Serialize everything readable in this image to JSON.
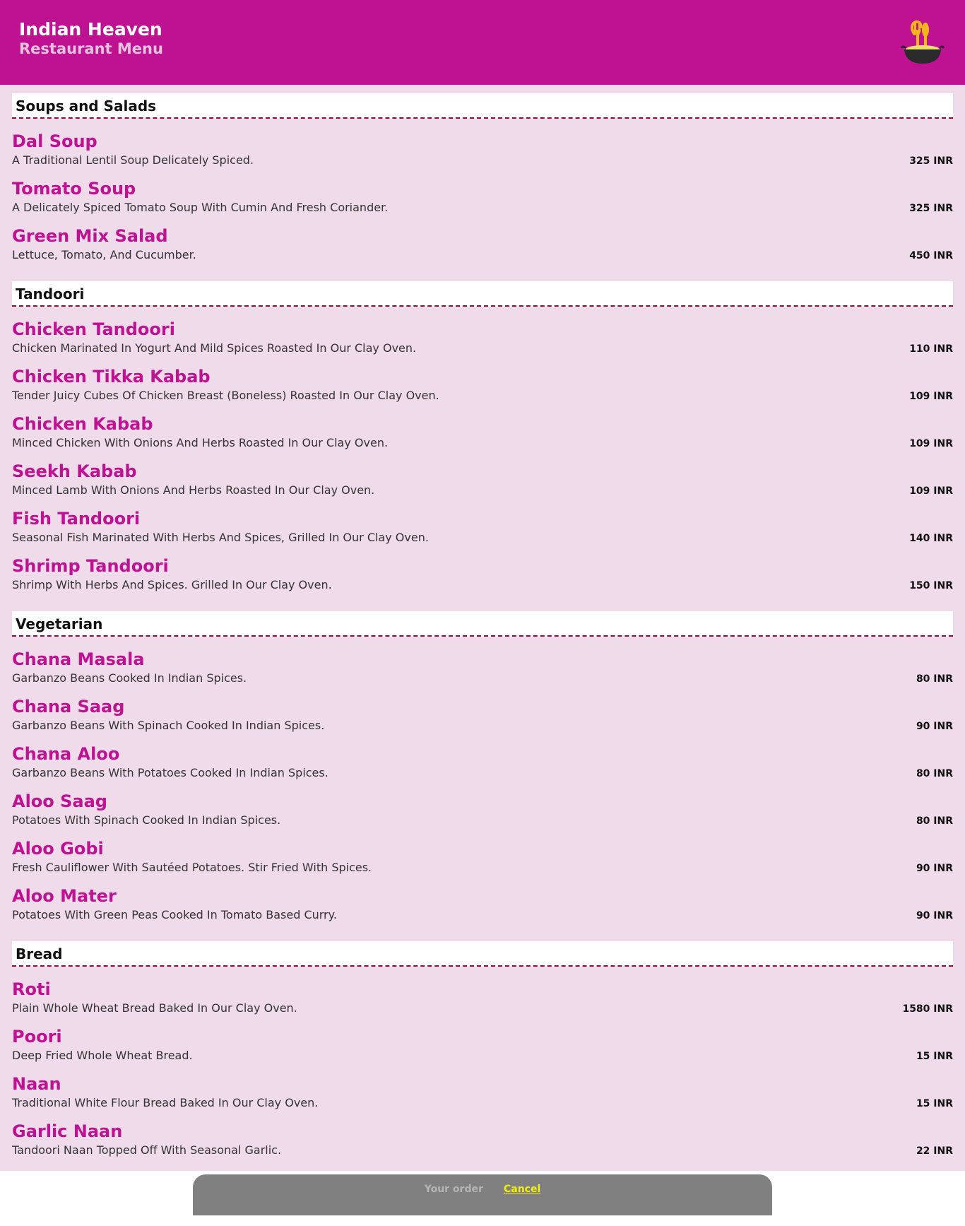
{
  "header": {
    "restaurant_name": "Indian Heaven",
    "subtitle": "Restaurant Menu",
    "logo_icon": "cooking-pot-icon"
  },
  "colors": {
    "brand": "#bf1293",
    "page_background": "#efdbea",
    "divider": "#8b0e3a",
    "order_bar": "#808080",
    "cancel_link": "#f4f200"
  },
  "sections": [
    {
      "title": "Soups and Salads",
      "items": [
        {
          "name": "Dal Soup",
          "description": "A Traditional Lentil Soup Delicately Spiced.",
          "price": "325 INR"
        },
        {
          "name": "Tomato Soup",
          "description": "A Delicately Spiced Tomato Soup With Cumin And Fresh Coriander.",
          "price": "325 INR"
        },
        {
          "name": "Green Mix Salad",
          "description": "Lettuce, Tomato, And Cucumber.",
          "price": "450 INR"
        }
      ]
    },
    {
      "title": "Tandoori",
      "items": [
        {
          "name": "Chicken Tandoori",
          "description": "Chicken Marinated In Yogurt And Mild Spices Roasted In Our Clay Oven.",
          "price": "110 INR"
        },
        {
          "name": "Chicken Tikka Kabab",
          "description": "Tender Juicy Cubes Of Chicken Breast (Boneless) Roasted In Our Clay Oven.",
          "price": "109 INR"
        },
        {
          "name": "Chicken Kabab",
          "description": "Minced Chicken With Onions And Herbs Roasted In Our Clay Oven.",
          "price": "109 INR"
        },
        {
          "name": "Seekh Kabab",
          "description": "Minced Lamb With Onions And Herbs Roasted In Our Clay Oven.",
          "price": "109 INR"
        },
        {
          "name": "Fish Tandoori",
          "description": "Seasonal Fish Marinated With Herbs And Spices, Grilled In Our Clay Oven.",
          "price": "140 INR"
        },
        {
          "name": "Shrimp Tandoori",
          "description": "Shrimp With Herbs And Spices. Grilled In Our Clay Oven.",
          "price": "150 INR"
        }
      ]
    },
    {
      "title": "Vegetarian",
      "items": [
        {
          "name": "Chana Masala",
          "description": "Garbanzo Beans Cooked In Indian Spices.",
          "price": "80 INR"
        },
        {
          "name": "Chana Saag",
          "description": "Garbanzo Beans With Spinach Cooked In Indian Spices.",
          "price": "90 INR"
        },
        {
          "name": "Chana Aloo",
          "description": "Garbanzo Beans With Potatoes Cooked In Indian Spices.",
          "price": "80 INR"
        },
        {
          "name": "Aloo Saag",
          "description": "Potatoes With Spinach Cooked In Indian Spices.",
          "price": "80 INR"
        },
        {
          "name": "Aloo Gobi",
          "description": "Fresh Cauliflower With Sautéed Potatoes. Stir Fried With Spices.",
          "price": "90 INR"
        },
        {
          "name": "Aloo Mater",
          "description": "Potatoes With Green Peas Cooked In Tomato Based Curry.",
          "price": "90 INR"
        }
      ]
    },
    {
      "title": "Bread",
      "items": [
        {
          "name": "Roti",
          "description": "Plain Whole Wheat Bread Baked In Our Clay Oven.",
          "price": "1580 INR"
        },
        {
          "name": "Poori",
          "description": "Deep Fried Whole Wheat Bread.",
          "price": "15 INR"
        },
        {
          "name": "Naan",
          "description": "Traditional White Flour Bread Baked In Our Clay Oven.",
          "price": "15 INR"
        },
        {
          "name": "Garlic Naan",
          "description": "Tandoori Naan Topped Off With Seasonal Garlic.",
          "price": "22 INR"
        }
      ]
    }
  ],
  "order_bar": {
    "label": "Your order",
    "cancel_label": "Cancel"
  }
}
